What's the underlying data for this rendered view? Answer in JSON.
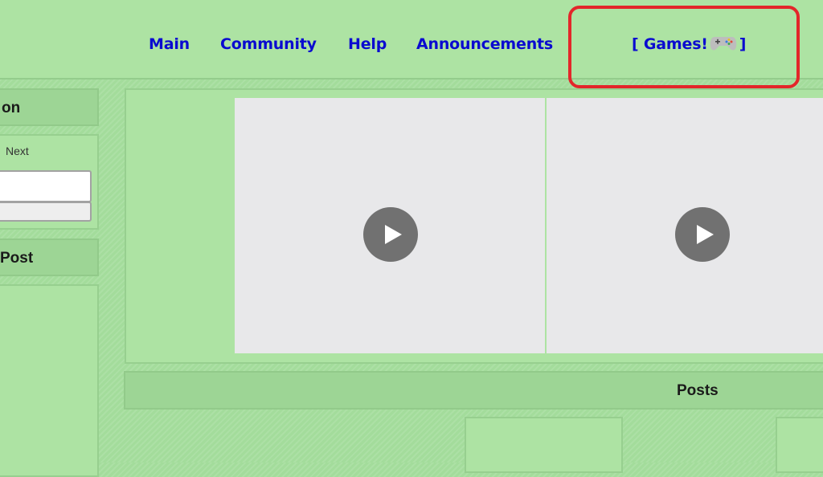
{
  "nav": {
    "items": [
      {
        "label": "Main"
      },
      {
        "label": "Community"
      },
      {
        "label": "Help"
      },
      {
        "label": "Announcements"
      }
    ],
    "games": {
      "prefix": "[ Games!",
      "suffix": "]",
      "icon": "gamepad-icon"
    }
  },
  "sidebar": {
    "section1_title": "on",
    "next_label": "Next",
    "input_value": "",
    "button_label": "",
    "section2_title": "Post"
  },
  "main": {
    "videos": [
      {
        "icon": "play-icon"
      },
      {
        "icon": "play-icon"
      }
    ],
    "posts_title": "Posts"
  },
  "colors": {
    "nav_link": "#0a0ad0",
    "highlight": "#e3262a",
    "background": "#ade3a3"
  }
}
